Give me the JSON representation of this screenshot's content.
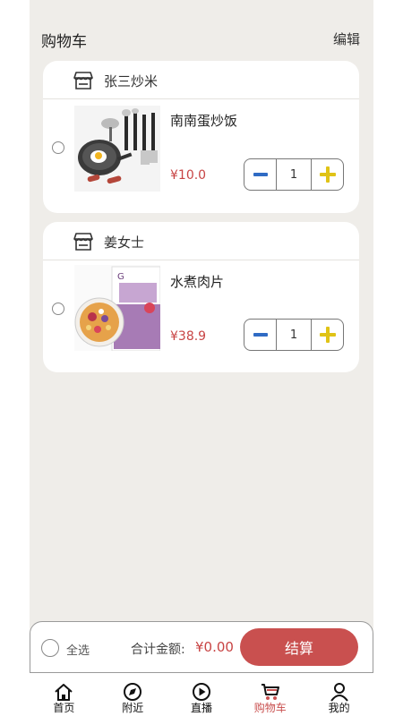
{
  "header": {
    "title": "购物车",
    "edit_label": "编辑"
  },
  "shops": [
    {
      "name": "张三炒米",
      "product": {
        "name": "南南蛋炒饭",
        "price": "¥10.0",
        "quantity": "1"
      }
    },
    {
      "name": "姜女士",
      "product": {
        "name": "水煮肉片",
        "price": "¥38.9",
        "quantity": "1"
      }
    }
  ],
  "checkout": {
    "select_all_label": "全选",
    "total_label": "合计金额:",
    "total_value": "¥0.00",
    "pay_button_label": "结算"
  },
  "tabbar": {
    "items": [
      {
        "label": "首页",
        "icon": "home-icon"
      },
      {
        "label": "附近",
        "icon": "nearby-icon"
      },
      {
        "label": "直播",
        "icon": "live-icon"
      },
      {
        "label": "购物车",
        "icon": "cart-icon",
        "active": true
      },
      {
        "label": "我的",
        "icon": "profile-icon"
      }
    ]
  },
  "colors": {
    "accent": "#c9504f",
    "price": "#c84444",
    "minus": "#2f6bc4",
    "plus": "#e0c316",
    "background": "#efede9"
  }
}
